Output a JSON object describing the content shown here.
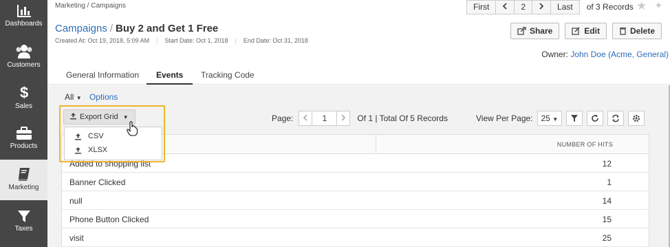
{
  "sidebar": {
    "items": [
      {
        "label": "Dashboards",
        "icon": "bar-chart-icon"
      },
      {
        "label": "Customers",
        "icon": "users-icon"
      },
      {
        "label": "Sales",
        "icon": "dollar-icon"
      },
      {
        "label": "Products",
        "icon": "briefcase-icon"
      },
      {
        "label": "Marketing",
        "icon": "book-icon",
        "active": true
      },
      {
        "label": "Taxes",
        "icon": "filter-icon"
      }
    ]
  },
  "breadcrumb": "Marketing / Campaigns",
  "top_pager": {
    "first": "First",
    "page": "2",
    "last": "Last",
    "records": "of 3 Records"
  },
  "title": {
    "link": "Campaigns",
    "sep": "/",
    "name": "Buy 2 and Get 1 Free"
  },
  "meta": {
    "created": "Created At: Oct 19, 2018, 5:09 AM",
    "start": "Start Date: Oct 1, 2018",
    "end": "End Date: Oct 31, 2018"
  },
  "actions": {
    "share": "Share",
    "edit": "Edit",
    "delete": "Delete"
  },
  "owner": {
    "label": "Owner:",
    "value": "John Doe (Acme, General)"
  },
  "tabs": [
    {
      "label": "General Information"
    },
    {
      "label": "Events",
      "active": true
    },
    {
      "label": "Tracking Code"
    }
  ],
  "filter": {
    "all": "All",
    "options": "Options"
  },
  "export": {
    "label": "Export Grid",
    "items": [
      "CSV",
      "XLSX"
    ]
  },
  "pager": {
    "label": "Page:",
    "value": "1",
    "summary": "Of 1 | Total Of 5 Records"
  },
  "view_per_page": {
    "label": "View Per Page:",
    "value": "25"
  },
  "grid": {
    "columns": [
      "",
      "NUMBER OF HITS"
    ],
    "rows": [
      {
        "name": "Added to shopping list",
        "hits": "12"
      },
      {
        "name": "Banner Clicked",
        "hits": "1"
      },
      {
        "name": "null",
        "hits": "14"
      },
      {
        "name": "Phone Button Clicked",
        "hits": "15"
      },
      {
        "name": "visit",
        "hits": "25"
      }
    ]
  },
  "colors": {
    "sidebar": "#464646",
    "link": "#2a6ebb",
    "highlight": "#f0b429"
  }
}
